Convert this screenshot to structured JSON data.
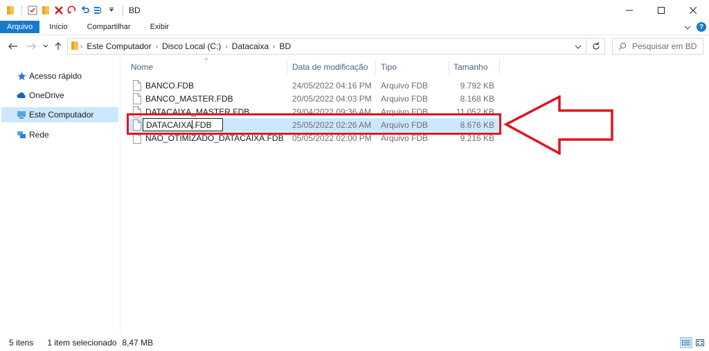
{
  "window": {
    "title": "BD",
    "controls": {
      "minimize": "minimize",
      "maximize": "maximize",
      "close": "close"
    }
  },
  "ribbon": {
    "tabs": [
      "Arquivo",
      "Início",
      "Compartilhar",
      "Exibir"
    ],
    "active_tab": "Arquivo",
    "accent": "#1979ca"
  },
  "address": {
    "crumbs": [
      "Este Computador",
      "Disco Local (C:)",
      "Datacaixa",
      "BD"
    ],
    "search_placeholder": "Pesquisar em BD"
  },
  "nav_pane": {
    "items": [
      {
        "label": "Acesso rápido",
        "icon": "star-icon",
        "selected": false
      },
      {
        "label": "OneDrive",
        "icon": "cloud-icon",
        "selected": false
      },
      {
        "label": "Este Computador",
        "icon": "computer-icon",
        "selected": true
      },
      {
        "label": "Rede",
        "icon": "network-icon",
        "selected": false
      }
    ]
  },
  "file_list": {
    "columns": [
      "Nome",
      "Data de modificação",
      "Tipo",
      "Tamanho"
    ],
    "rows": [
      {
        "name": "BANCO.FDB",
        "date": "24/05/2022 04:16 PM",
        "type": "Arquivo FDB",
        "size": "9.792 KB"
      },
      {
        "name": "BANCO_MASTER.FDB",
        "date": "20/05/2022 04:03 PM",
        "type": "Arquivo FDB",
        "size": "8.168 KB"
      },
      {
        "name": "DATACAIXA_MASTER.FDB",
        "date": "29/04/2022 09:36 AM",
        "type": "Arquivo FDB",
        "size": "11.052 KB"
      },
      {
        "name": "DATACAIXA.FDB",
        "date": "25/05/2022 02:26 AM",
        "type": "Arquivo FDB",
        "size": "8.676 KB",
        "selected": true,
        "rename_value_before_caret": "DATACAIXA",
        "rename_value_after_caret": ".FDB"
      },
      {
        "name": "NAO_OTIMIZADO_DATACAIXA.FDB",
        "date": "05/05/2022 02:00 PM",
        "type": "Arquivo FDB",
        "size": "9.216 KB"
      }
    ],
    "selection_color": "#cce8ff",
    "annotation_color": "#e0141e"
  },
  "status": {
    "item_count": "5 itens",
    "selected": "1 item selecionado",
    "size": "8,47 MB"
  }
}
